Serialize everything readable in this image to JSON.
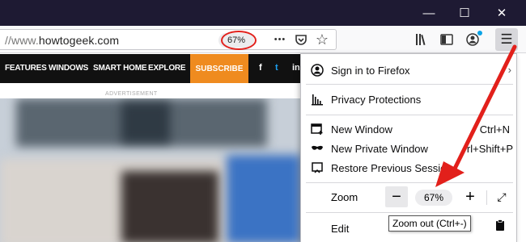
{
  "window": {
    "minimize": "—",
    "maximize": "☐",
    "close": "✕"
  },
  "urlbar": {
    "prefix": "//www.",
    "host": "howtogeek.com",
    "zoom_badge": "67%"
  },
  "toolbar": {
    "page_actions_icon": "•••",
    "pocket_icon": "pocket-icon",
    "bookmark_icon": "☆",
    "library_icon": "library-icon",
    "sidebar_icon": "sidebar-icon",
    "account_icon": "account-icon",
    "menu_icon": "☰"
  },
  "site": {
    "nav_items": [
      "FEATURES",
      "WINDOWS",
      "SMART HOME",
      "EXPLORE"
    ],
    "subscribe": "SUBSCRIBE",
    "social": [
      "f",
      "t",
      "in"
    ],
    "ad_label": "ADVERTISEMENT"
  },
  "menu": {
    "sign_in": "Sign in to Firefox",
    "privacy": "Privacy Protections",
    "new_window": "New Window",
    "new_window_shortcut": "Ctrl+N",
    "new_private_window": "New Private Window",
    "new_private_window_shortcut": "rl+Shift+P",
    "restore_session": "Restore Previous Session",
    "zoom_label": "Zoom",
    "zoom_minus": "−",
    "zoom_level": "67%",
    "zoom_plus": "+",
    "fullscreen_icon": "⤢",
    "edit_label": "Edit"
  },
  "tooltip": {
    "text": "Zoom out (Ctrl+-)"
  },
  "colors": {
    "titlebar": "#1e1a33",
    "arrow": "#e2201b",
    "subscribe": "#ef8b1f"
  }
}
